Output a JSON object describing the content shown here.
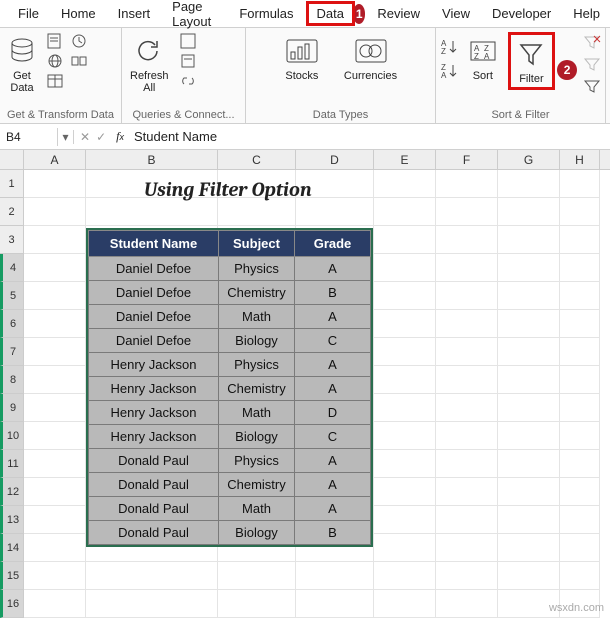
{
  "ribbon": {
    "tabs": [
      "File",
      "Home",
      "Insert",
      "Page Layout",
      "Formulas",
      "Data",
      "Review",
      "View",
      "Developer",
      "Help"
    ],
    "active_tab": "Data",
    "badges": {
      "data_tab": "1",
      "filter_btn": "2"
    },
    "groups": {
      "g1": {
        "label": "Get & Transform Data",
        "get_data": "Get\nData"
      },
      "g2": {
        "label": "Queries & Connect...",
        "refresh_all": "Refresh\nAll"
      },
      "g3": {
        "label": "Data Types",
        "stocks": "Stocks",
        "currencies": "Currencies"
      },
      "g4": {
        "label": "Sort & Filter",
        "sort": "Sort",
        "filter": "Filter"
      }
    }
  },
  "namebox": {
    "cell_ref": "B4",
    "formula": "Student Name"
  },
  "columns": [
    "A",
    "B",
    "C",
    "D",
    "E",
    "F",
    "G",
    "H"
  ],
  "title": "Using Filter Option",
  "table": {
    "headers": [
      "Student Name",
      "Subject",
      "Grade"
    ],
    "rows": [
      [
        "Daniel Defoe",
        "Physics",
        "A"
      ],
      [
        "Daniel Defoe",
        "Chemistry",
        "B"
      ],
      [
        "Daniel Defoe",
        "Math",
        "A"
      ],
      [
        "Daniel Defoe",
        "Biology",
        "C"
      ],
      [
        "Henry Jackson",
        "Physics",
        "A"
      ],
      [
        "Henry Jackson",
        "Chemistry",
        "A"
      ],
      [
        "Henry Jackson",
        "Math",
        "D"
      ],
      [
        "Henry Jackson",
        "Biology",
        "C"
      ],
      [
        "Donald Paul",
        "Physics",
        "A"
      ],
      [
        "Donald Paul",
        "Chemistry",
        "A"
      ],
      [
        "Donald Paul",
        "Math",
        "A"
      ],
      [
        "Donald Paul",
        "Biology",
        "B"
      ]
    ]
  },
  "watermark": "wsxdn.com"
}
